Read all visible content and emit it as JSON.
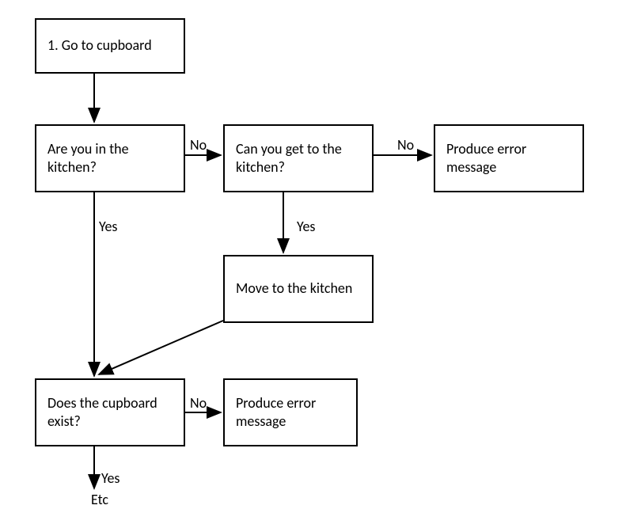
{
  "nodes": {
    "start": "1. Go to cupboard",
    "q_kitchen": "Are you in the kitchen?",
    "q_get_kitchen": "Can you get to the kitchen?",
    "error_top": "Produce error message",
    "move_kitchen": "Move to the kitchen",
    "q_cupboard": "Does the cupboard exist?",
    "error_bottom": "Produce error message"
  },
  "labels": {
    "no1": "No",
    "no2": "No",
    "no3": "No",
    "yes1": "Yes",
    "yes2": "Yes",
    "yes3": "Yes",
    "etc": "Etc"
  }
}
